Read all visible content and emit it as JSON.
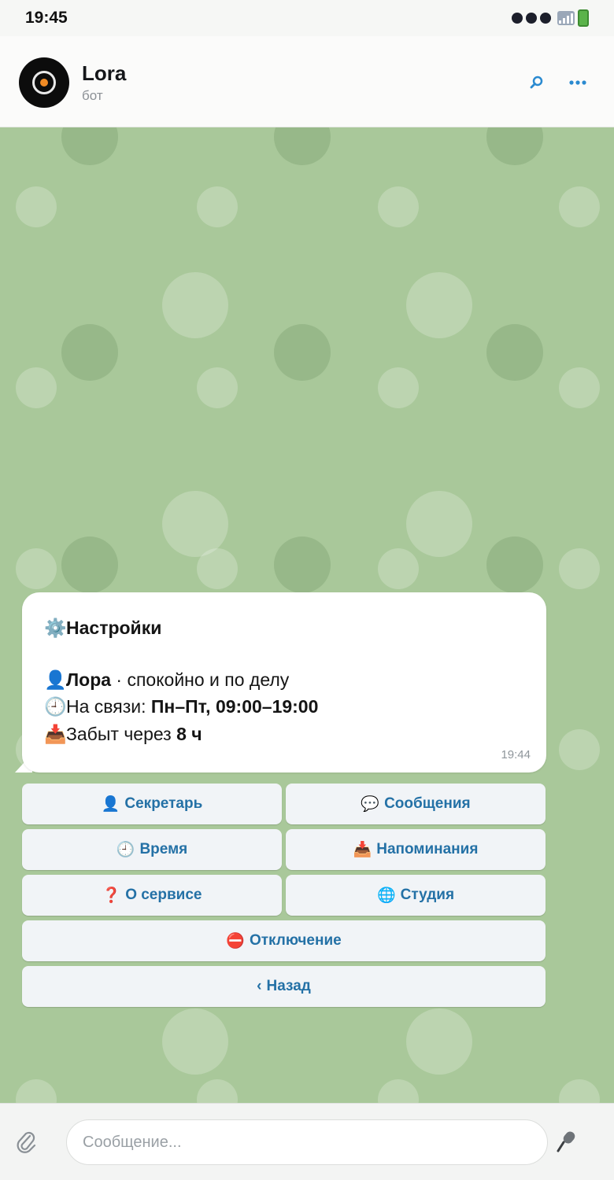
{
  "status_bar": {
    "time": "19:45"
  },
  "chat": {
    "title": "Lora",
    "subtitle": "бот"
  },
  "header_icons": [
    "search-icon",
    "more-icon"
  ],
  "message": {
    "title": "Настройки",
    "title_icon": "⚙️",
    "lines": [
      {
        "icon": "👤",
        "bold": "Лора",
        "text": " · спокойно и по делу"
      },
      {
        "icon": "🕘",
        "text": "На связи: ",
        "bold": "Пн–Пт, 09:00–19:00"
      },
      {
        "icon": "📥",
        "text": "Забыт через ",
        "bold": "8 ч"
      }
    ],
    "time": "19:44"
  },
  "keyboard": [
    {
      "icon": "👤",
      "label": "Секретарь"
    },
    {
      "icon": "💬",
      "label": "Сообщения"
    },
    {
      "icon": "🕘",
      "label": "Время"
    },
    {
      "icon": "📥",
      "label": "Напоминания"
    },
    {
      "icon": "❓",
      "label": "О сервисе"
    },
    {
      "icon": "🌐",
      "label": "Студия"
    },
    {
      "icon": "⛔",
      "label": "Отключение"
    },
    {
      "icon": "‹",
      "label": "Назад"
    }
  ],
  "input": {
    "placeholder": "Сообщение..."
  },
  "colors": {
    "chat_background": "#a9c89a",
    "accent": "#2471a6"
  }
}
